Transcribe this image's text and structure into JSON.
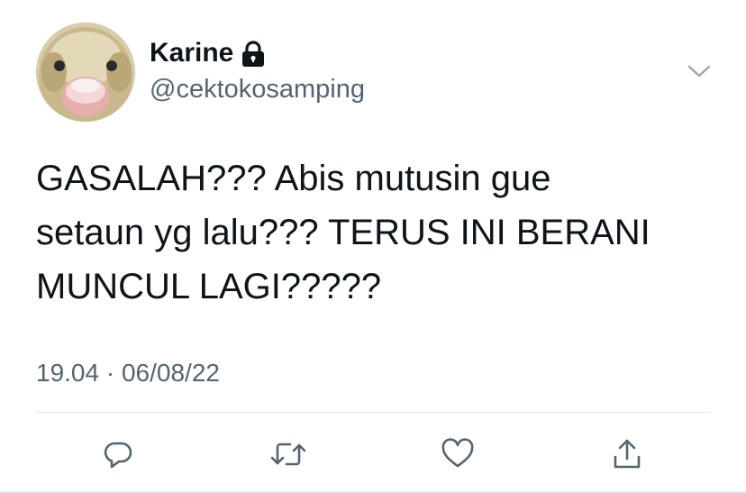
{
  "user": {
    "display_name": "Karine",
    "handle": "@cektokosamping",
    "protected_icon": "lock-icon",
    "avatar": "duckling-avatar"
  },
  "tweet": {
    "text": "GASALAH??? Abis mutusin gue\nsetaun yg lalu??? TERUS INI BERANI\nMUNCUL LAGI?????",
    "time": "19.04",
    "separator": "·",
    "date": "06/08/22"
  },
  "actions": [
    {
      "name": "reply",
      "icon": "reply-icon"
    },
    {
      "name": "retweet",
      "icon": "retweet-icon"
    },
    {
      "name": "like",
      "icon": "heart-icon"
    },
    {
      "name": "share",
      "icon": "share-icon"
    }
  ],
  "colors": {
    "text": "#0f1419",
    "secondary": "#536471",
    "divider": "#e1e6ea",
    "background": "#ffffff"
  }
}
